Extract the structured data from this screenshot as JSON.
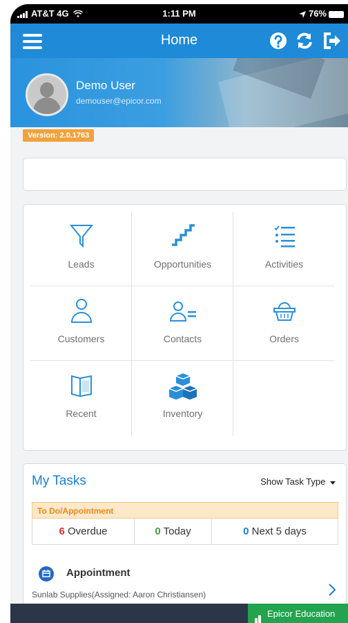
{
  "status_bar": {
    "carrier": "AT&T 4G",
    "time": "1:11 PM",
    "battery": "76%"
  },
  "navbar": {
    "title": "Home"
  },
  "profile": {
    "name": "Demo User",
    "email": "demouser@epicor.com"
  },
  "version": "Version: 2.0.1763",
  "tiles": [
    {
      "label": "Leads",
      "icon": "filter-icon"
    },
    {
      "label": "Opportunities",
      "icon": "stairs-icon"
    },
    {
      "label": "Activities",
      "icon": "checklist-icon"
    },
    {
      "label": "Customers",
      "icon": "person-icon"
    },
    {
      "label": "Contacts",
      "icon": "contact-list-icon"
    },
    {
      "label": "Orders",
      "icon": "basket-icon"
    },
    {
      "label": "Recent",
      "icon": "book-icon"
    },
    {
      "label": "Inventory",
      "icon": "boxes-icon"
    }
  ],
  "tasks": {
    "title": "My Tasks",
    "type_button": "Show Task Type",
    "group": "To Do/Appointment",
    "overdue_count": "6",
    "overdue_label": "Overdue",
    "today_count": "0",
    "today_label": "Today",
    "next_count": "0",
    "next_label": "Next 5 days",
    "item_title": "Appointment",
    "item_sub": "Sunlab Supplies(Assigned: Aaron Christiansen)"
  },
  "footer": {
    "badge": "Epicor Education"
  },
  "colors": {
    "accent": "#1e8ad8",
    "overdue": "#d8302e",
    "today": "#3fa244",
    "version_badge": "#f0a23c",
    "edu_badge": "#23a34e"
  }
}
